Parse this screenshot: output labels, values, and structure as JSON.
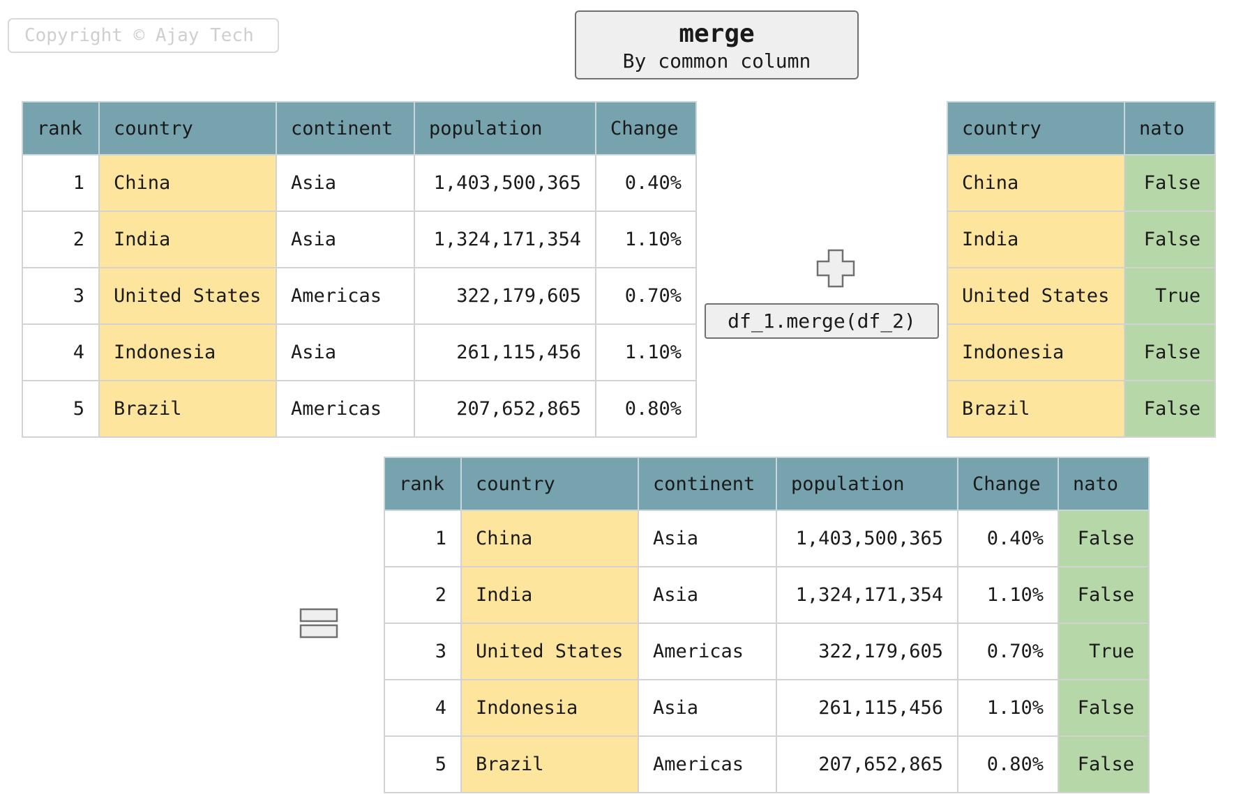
{
  "copyright": "Copyright © Ajay Tech",
  "title": {
    "main": "merge",
    "sub": "By common column"
  },
  "code": "df_1.merge(df_2)",
  "icons": {
    "plus": "plus-icon",
    "equals": "equals-icon"
  },
  "colors": {
    "header": "#76a3ae",
    "key_column": "#fee59e",
    "nato_column": "#b6d7a8"
  },
  "df_1": {
    "headers": [
      "rank",
      "country",
      "continent",
      "population",
      "Change"
    ],
    "rows": [
      [
        "1",
        "China",
        "Asia",
        "1,403,500,365",
        "0.40%"
      ],
      [
        "2",
        "India",
        "Asia",
        "1,324,171,354",
        "1.10%"
      ],
      [
        "3",
        "United States",
        "Americas",
        "322,179,605",
        "0.70%"
      ],
      [
        "4",
        "Indonesia",
        "Asia",
        "261,115,456",
        "1.10%"
      ],
      [
        "5",
        "Brazil",
        "Americas",
        "207,652,865",
        "0.80%"
      ]
    ]
  },
  "df_2": {
    "headers": [
      "country",
      "nato"
    ],
    "rows": [
      [
        "China",
        "False"
      ],
      [
        "India",
        "False"
      ],
      [
        "United States",
        "True"
      ],
      [
        "Indonesia",
        "False"
      ],
      [
        "Brazil",
        "False"
      ]
    ]
  },
  "result": {
    "headers": [
      "rank",
      "country",
      "continent",
      "population",
      "Change",
      "nato"
    ],
    "rows": [
      [
        "1",
        "China",
        "Asia",
        "1,403,500,365",
        "0.40%",
        "False"
      ],
      [
        "2",
        "India",
        "Asia",
        "1,324,171,354",
        "1.10%",
        "False"
      ],
      [
        "3",
        "United States",
        "Americas",
        "322,179,605",
        "0.70%",
        "True"
      ],
      [
        "4",
        "Indonesia",
        "Asia",
        "261,115,456",
        "1.10%",
        "False"
      ],
      [
        "5",
        "Brazil",
        "Americas",
        "207,652,865",
        "0.80%",
        "False"
      ]
    ]
  }
}
